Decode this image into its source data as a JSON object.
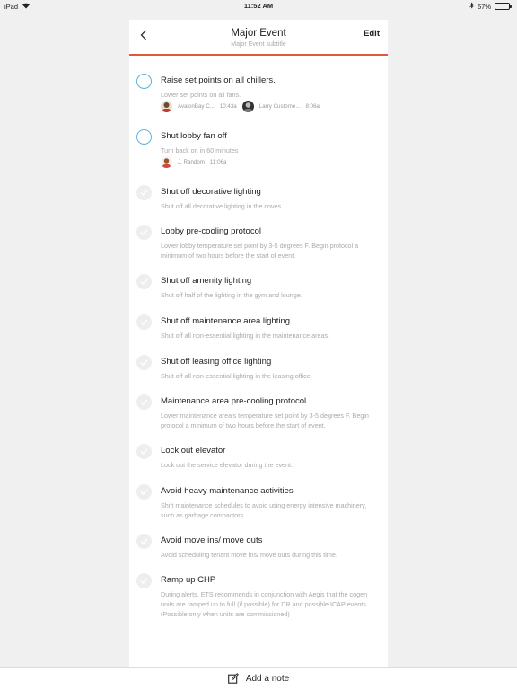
{
  "status_bar": {
    "device": "iPad",
    "time": "11:52 AM",
    "battery": "67%",
    "battery_level": 0.67
  },
  "header": {
    "title": "Major Event",
    "subtitle": "Major Event subtitle",
    "edit_label": "Edit",
    "accent_color": "#e2583c"
  },
  "items": [
    {
      "title": "Raise set points on all chillers.",
      "desc": "Lower set points on all fans.",
      "done": false,
      "assignees": [
        {
          "name": "AvalonBay C...",
          "time": "10:43a"
        },
        {
          "name": "Larry Custome...",
          "time": "8:06a"
        }
      ]
    },
    {
      "title": "Shut lobby fan off",
      "desc": "Turn back on in 60 minutes",
      "done": false,
      "assignees": [
        {
          "name": "J. Random",
          "time": "11:06a"
        }
      ]
    },
    {
      "title": "Shut off decorative lighting",
      "desc": "Shut off all decorative lighting in the coves.",
      "done": true
    },
    {
      "title": "Lobby pre-cooling protocol",
      "desc": "Lower lobby temperature set point by 3-5 degrees F. Begin protocol a minimum of two hours before the start of event.",
      "done": true
    },
    {
      "title": "Shut off amenity lighting",
      "desc": "Shut off half of the lighting in the gym and lounge.",
      "done": true
    },
    {
      "title": "Shut off maintenance area lighting",
      "desc": "Shut off all non-essential lighting in the maintenance areas.",
      "done": true
    },
    {
      "title": "Shut off leasing office lighting",
      "desc": "Shut off all non-essential lighting in the leasing office.",
      "done": true
    },
    {
      "title": "Maintenance area pre-cooling protocol",
      "desc": "Lower maintenance area's temperature set point by 3-5 degrees F. Begin protocol a minimum of two hours before the start of event.",
      "done": true
    },
    {
      "title": "Lock out elevator",
      "desc": "Lock out the service elevator during the event.",
      "done": true
    },
    {
      "title": "Avoid heavy maintenance activities",
      "desc": "Shift maintenance schedules to avoid using energy intensive machinery, such as garbage compactors.",
      "done": true
    },
    {
      "title": "Avoid move ins/ move outs",
      "desc": "Avoid scheduling tenant move ins/ move outs during this time.",
      "done": true
    },
    {
      "title": "Ramp up CHP",
      "desc": "During alerts, ETS recommends in conjunction with Aegis that the cogen units are ramped up to full (if possible) for DR and possible ICAP events. (Possible only when units are commissioned)",
      "done": true
    }
  ],
  "footer": {
    "add_note_label": "Add a note"
  },
  "colors": {
    "open_check": "#5db4de",
    "done_check": "#eeeeee"
  }
}
